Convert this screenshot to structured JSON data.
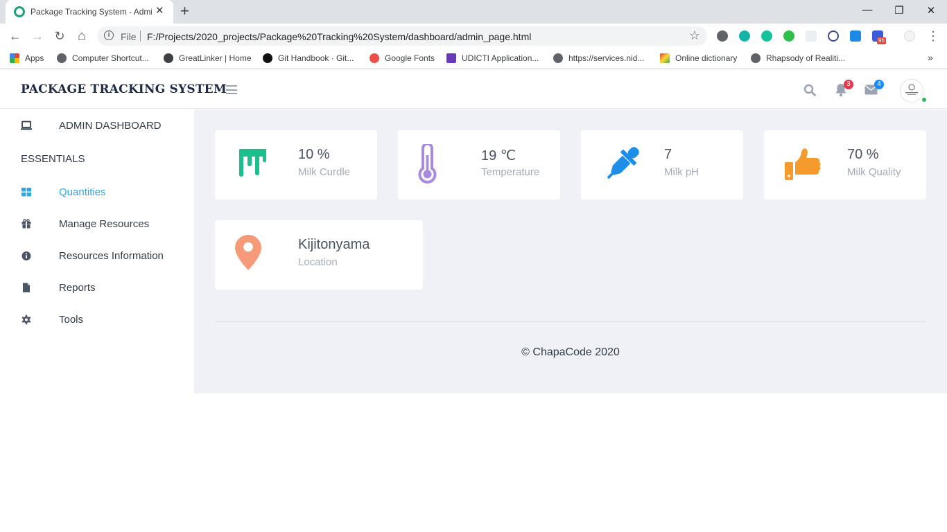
{
  "browser": {
    "tab_title": "Package Tracking System - Admin",
    "tab_close": "✕",
    "new_tab": "+",
    "window_controls": {
      "minimize": "—",
      "restore": "❐",
      "close": "✕"
    },
    "nav": {
      "back": "←",
      "forward": "→",
      "reload": "↻",
      "home": "⌂"
    },
    "address": {
      "scheme_label": "File",
      "url": "F:/Projects/2020_projects/Package%20Tracking%20System/dashboard/admin_page.html",
      "star": "☆"
    },
    "menu": "⋮",
    "bookmarks": [
      {
        "label": "Apps",
        "icon": "apps-grid-icon"
      },
      {
        "label": "Computer Shortcut...",
        "icon": "globe-icon"
      },
      {
        "label": "GreatLinker | Home",
        "icon": "share-icon"
      },
      {
        "label": "Git Handbook · Git...",
        "icon": "github-icon"
      },
      {
        "label": "Google Fonts",
        "icon": "google-fonts-icon"
      },
      {
        "label": "UDICTI Application...",
        "icon": "form-icon"
      },
      {
        "label": "https://services.nid...",
        "icon": "globe-icon"
      },
      {
        "label": "Online dictionary",
        "icon": "dictionary-icon"
      },
      {
        "label": "Rhapsody of Realiti...",
        "icon": "globe-icon"
      }
    ],
    "bookmarks_overflow": "»",
    "extension_badge": "9h"
  },
  "app": {
    "brand": "PACKAGE TRACKING SYSTEM",
    "notifications_count": "3",
    "messages_count": "4",
    "colors": {
      "accent": "#2ea7df",
      "notif_badge": "#e0394c",
      "msg_badge": "#1b8cf2",
      "online": "#2eb85c"
    }
  },
  "sidebar": {
    "dashboard_label": "ADMIN DASHBOARD",
    "section_heading": "ESSENTIALS",
    "items": [
      {
        "label": "Quantities",
        "icon": "grid-icon",
        "active": true
      },
      {
        "label": "Manage Resources",
        "icon": "gift-icon",
        "active": false
      },
      {
        "label": "Resources Information",
        "icon": "info-icon",
        "active": false
      },
      {
        "label": "Reports",
        "icon": "file-icon",
        "active": false
      },
      {
        "label": "Tools",
        "icon": "cog-icon",
        "active": false
      }
    ]
  },
  "cards": [
    {
      "value": "10 %",
      "label": "Milk Curdle",
      "icon": "curdle-drip-icon",
      "color": "#1cbf8c"
    },
    {
      "value": "19 ℃",
      "label": "Temperature",
      "icon": "thermometer-icon",
      "color": "#a78bdc"
    },
    {
      "value": "7",
      "label": "Milk pH",
      "icon": "eyedropper-icon",
      "color": "#1d8fe8"
    },
    {
      "value": "70 %",
      "label": "Milk Quality",
      "icon": "thumbs-up-icon",
      "color": "#f59a2d"
    },
    {
      "value": "Kijitonyama",
      "label": "Location",
      "icon": "map-pin-icon",
      "color": "#f69a7a"
    }
  ],
  "footer": "© ChapaCode 2020"
}
